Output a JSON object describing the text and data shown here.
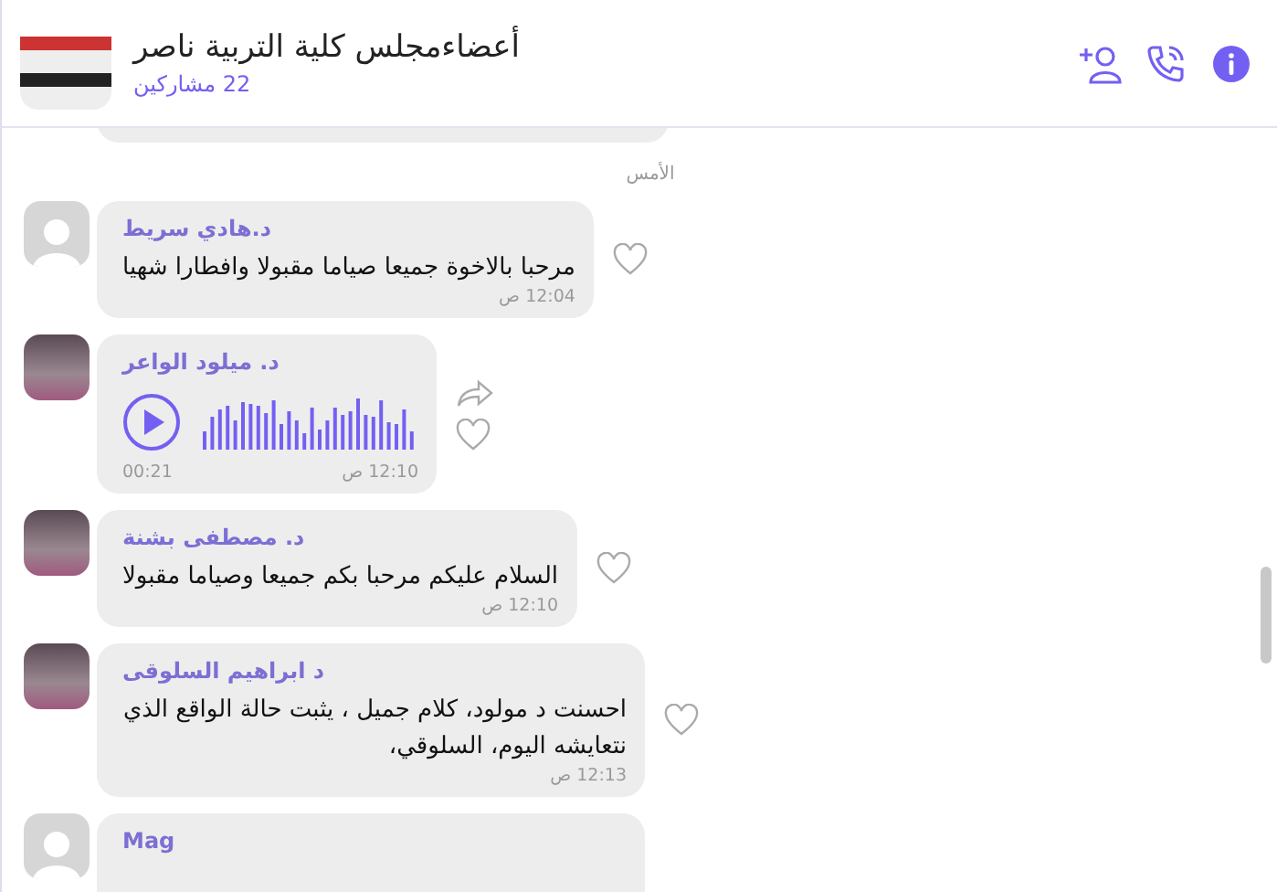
{
  "header": {
    "title": "أعضاءمجلس كلية التربية ناصر",
    "participants": "22 مشاركين"
  },
  "date_divider": "الأمس",
  "messages": [
    {
      "kind": "text",
      "avatar": {
        "kind": "default"
      },
      "sender": "د.هادي سريط",
      "text": "مرحبا بالاخوة جميعا صياما مقبولا وافطارا شهيا",
      "time": "12:04 ص"
    },
    {
      "kind": "voice",
      "avatar": {
        "kind": "photo"
      },
      "sender": "د. ميلود الواعر",
      "duration": "00:21",
      "time": "12:10 ص"
    },
    {
      "kind": "text",
      "avatar": {
        "kind": "photo"
      },
      "sender": "د. مصطفى بشنة",
      "text": "السلام عليكم  مرحبا بكم جميعا  وصياما مقبولا",
      "time": "12:10 ص"
    },
    {
      "kind": "text",
      "avatar": {
        "kind": "photo"
      },
      "sender": "د ابراهيم السلوقى",
      "text": "احسنت د مولود، كلام جميل ، يثبت حالة الواقع الذي نتعايشه اليوم، السلوقي،",
      "time": "12:13 ص"
    },
    {
      "kind": "cut",
      "avatar": {
        "kind": "default"
      },
      "sender": "Mag"
    }
  ]
}
